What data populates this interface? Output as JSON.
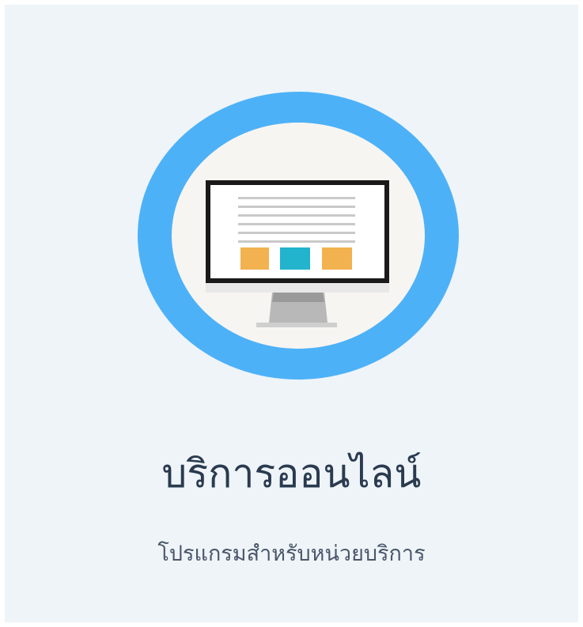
{
  "card": {
    "title": "บริการออนไลน์",
    "subtitle": "โปรแกรมสำหรับหน่วยบริการ",
    "icon": "monitor-icon",
    "colors": {
      "background": "#eef4f8",
      "ring": "#4db1f7",
      "ring_inner": "#f7f5f2",
      "orange_block": "#f2b24f",
      "teal_block": "#22b3cd",
      "title_text": "#2a3a4f"
    }
  }
}
